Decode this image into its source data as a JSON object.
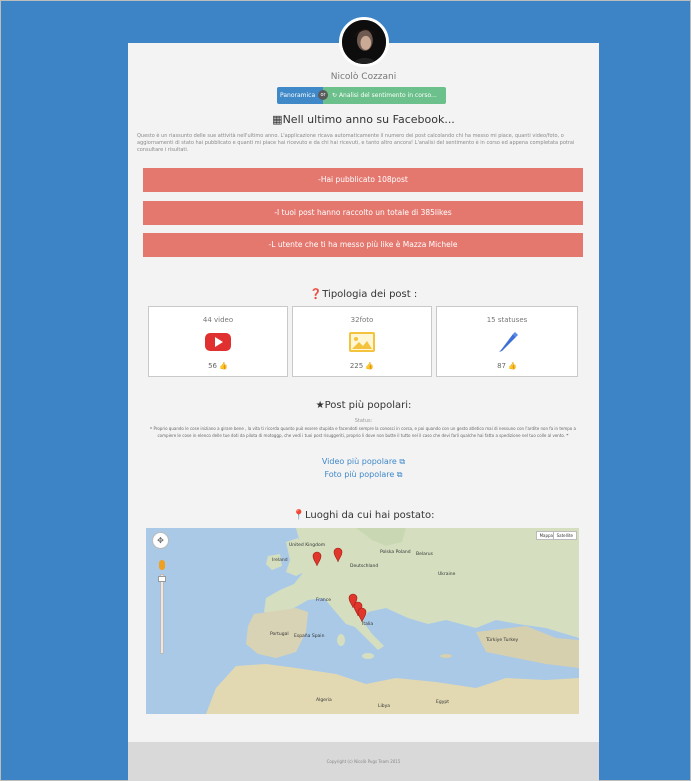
{
  "user": {
    "name": "Nicolò Cozzani"
  },
  "nav": {
    "tabs": [
      {
        "label": "Panoramica"
      },
      {
        "label": "Analisi del sentimento in corso..."
      }
    ],
    "separator": "or"
  },
  "summary": {
    "title": "Nell ultimo anno su Facebook...",
    "intro": "Questo è un riassunto delle sue attività nell'ultimo anno. L'applicazione ricava automaticamente il numero dei post calcolando chi ha messo mi piace, quanti video/foto, o aggiornamenti di stato hai pubblicato e quanti mi piace hai ricevuto e da chi hai ricevuti, e tanto altro ancora! L'analisi del sentimento è in corso ed appena completata potrai consultare i risultati.",
    "stats": [
      "-Hai pubblicato 108post",
      "-I tuoi post hanno raccolto un totale di 385likes",
      "-L utente che ti ha messo più like è Mazza Michele"
    ]
  },
  "types": {
    "title": "Tipologia dei post :",
    "items": [
      {
        "label": "44 video",
        "likes": "56",
        "icon": "video-play-icon",
        "color": "#e03030"
      },
      {
        "label": "32foto",
        "likes": "225",
        "icon": "photo-icon",
        "color": "#f0c030"
      },
      {
        "label": "15 statuses",
        "likes": "87",
        "icon": "pencil-icon",
        "color": "#3d6fd6"
      }
    ]
  },
  "popular": {
    "title": "Post più popolari:",
    "kind": "Status:",
    "quote": "Proprio quando le cose iniziano a girare bene , la vita ti ricorda quanto può essere stupida e facendoti sempre la conosci in corsa, e poi quando con un gesto atletico mai di nessuno con l'ardite non fa in tempo a compiere le cose in elenco delle tue doti da pilota di motoggp, che vedi i tuoi post risuggeriti, proprio li dove non butte il tutto nel il caso che devi farli qualche hai fatto a spedizione nel tuo colle al vento.",
    "links": [
      "Video più popolare",
      "Foto più popolare"
    ]
  },
  "places": {
    "title": "Luoghi da cui hai postato:",
    "map_buttons": [
      "Mappa",
      "Satellite"
    ],
    "map_labels": [
      "Ireland",
      "United Kingdom",
      "Deutschland",
      "Polska Poland",
      "Belarus",
      "Ukraine",
      "France",
      "España Spain",
      "Portugal",
      "Italia",
      "Türkiye Turkey",
      "Algeria",
      "Libya",
      "Egypt"
    ]
  },
  "footer": {
    "text": "Copyright (c) Nicolò Pugs Team 2015"
  },
  "colors": {
    "background": "#3d84c6",
    "stat_bar": "#e4786f",
    "link": "#3f89c9"
  }
}
